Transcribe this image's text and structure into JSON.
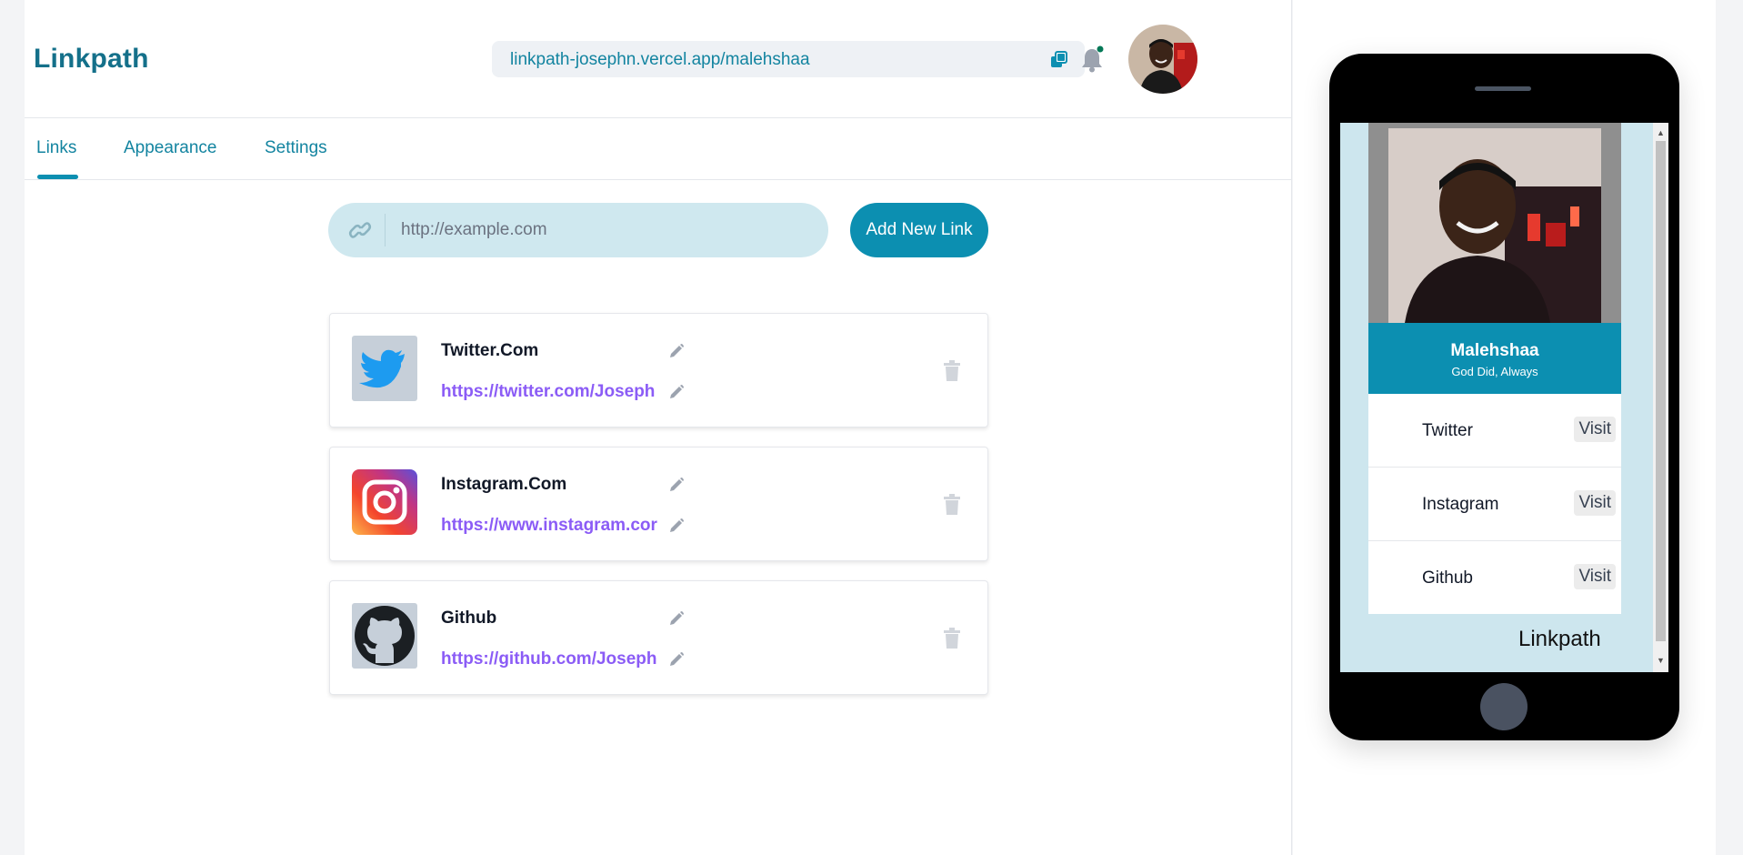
{
  "app": {
    "brand": "Linkpath"
  },
  "header": {
    "share_url": "linkpath-josephn.vercel.app/malehshaa",
    "copy_icon": "copy-icon",
    "bell_icon": "bell-icon"
  },
  "tabs": [
    {
      "label": "Links",
      "active": true
    },
    {
      "label": "Appearance",
      "active": false
    },
    {
      "label": "Settings",
      "active": false
    }
  ],
  "new_link": {
    "placeholder": "http://example.com",
    "value": "",
    "add_button": "Add New Link"
  },
  "links": [
    {
      "title": "Twitter.Com",
      "url": "https://twitter.com/Joseph",
      "icon": "twitter-icon"
    },
    {
      "title": "Instagram.Com",
      "url": "https://www.instagram.cor",
      "icon": "instagram-icon"
    },
    {
      "title": "Github",
      "url": "https://github.com/Joseph",
      "icon": "github-icon"
    }
  ],
  "preview": {
    "name": "Malehshaa",
    "bio": "God Did, Always",
    "links": [
      {
        "title": "Twitter",
        "action": "Visit"
      },
      {
        "title": "Instagram",
        "action": "Visit"
      },
      {
        "title": "Github",
        "action": "Visit"
      }
    ],
    "footer_brand": "Linkpath"
  },
  "colors": {
    "accent": "#0c8fb1",
    "brand": "#14708a",
    "link_url": "#8b5cf6",
    "input_bg": "#cfe8ef",
    "preview_bg": "#cde6ee"
  }
}
